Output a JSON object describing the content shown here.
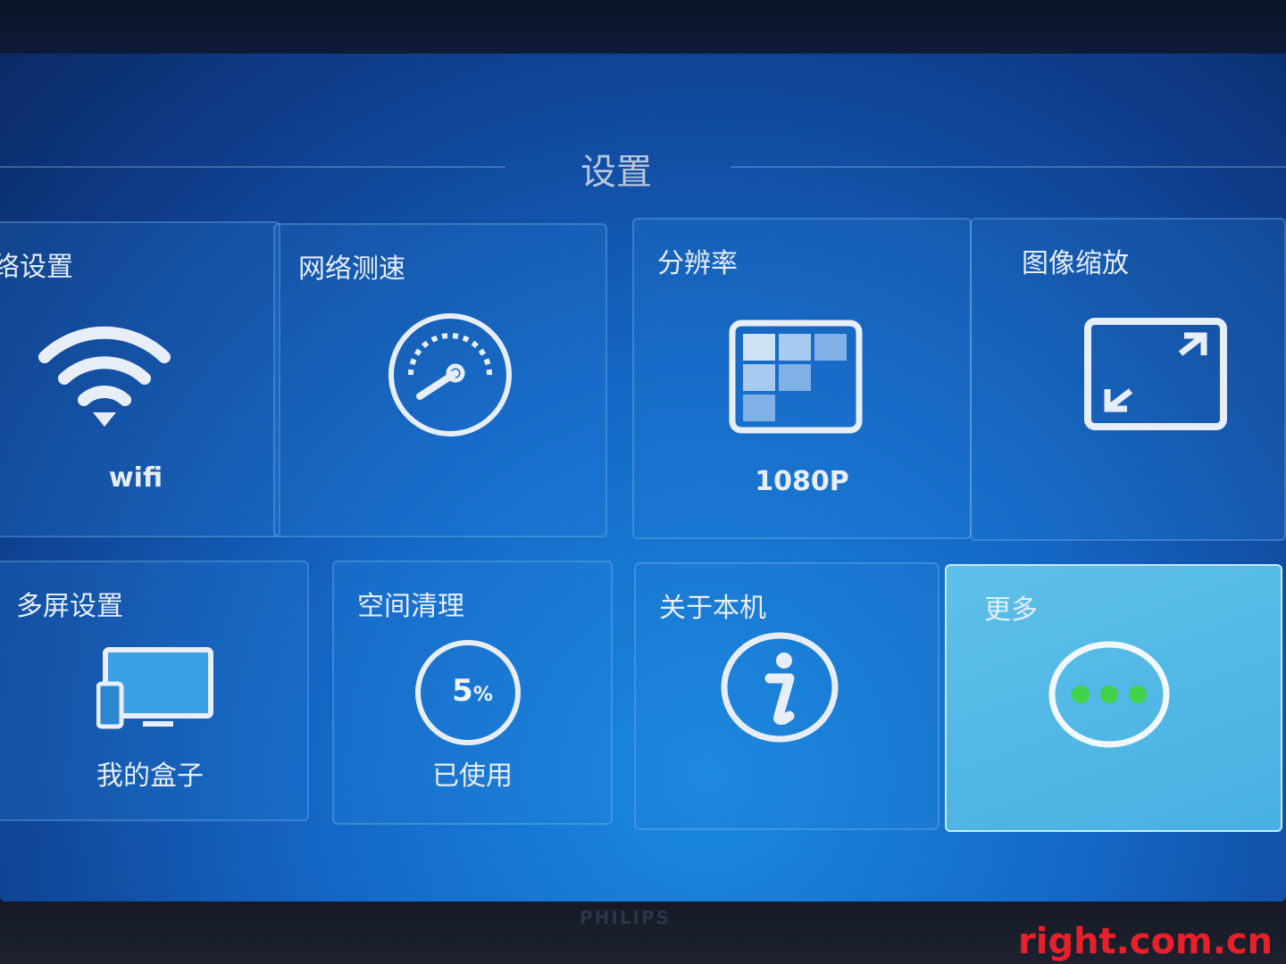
{
  "page": {
    "title": "设置"
  },
  "tiles": {
    "network": {
      "title": "络设置",
      "caption": "wifi",
      "icon": "wifi-icon"
    },
    "speed_test": {
      "title": "网络测速",
      "icon": "speedometer-icon"
    },
    "resolution": {
      "title": "分辨率",
      "caption": "1080P",
      "icon": "resolution-grid-icon"
    },
    "zoom": {
      "title": "图像缩放",
      "icon": "expand-arrows-icon"
    },
    "multi_screen": {
      "title": "多屏设置",
      "caption": "我的盒子",
      "icon": "phone-monitor-icon"
    },
    "cleanup": {
      "title": "空间清理",
      "caption": "已使用",
      "usage_value": "5",
      "usage_unit": "%",
      "icon": "usage-ring-icon"
    },
    "about": {
      "title": "关于本机",
      "icon": "info-icon"
    },
    "more": {
      "title": "更多",
      "icon": "more-dots-icon"
    }
  },
  "device": {
    "brand": "PHILIPS"
  },
  "watermark": {
    "text": "right.com.cn"
  },
  "colors": {
    "accent_tile": "#52b6e6",
    "dots": "#3fd24a",
    "watermark": "#e8202a"
  }
}
